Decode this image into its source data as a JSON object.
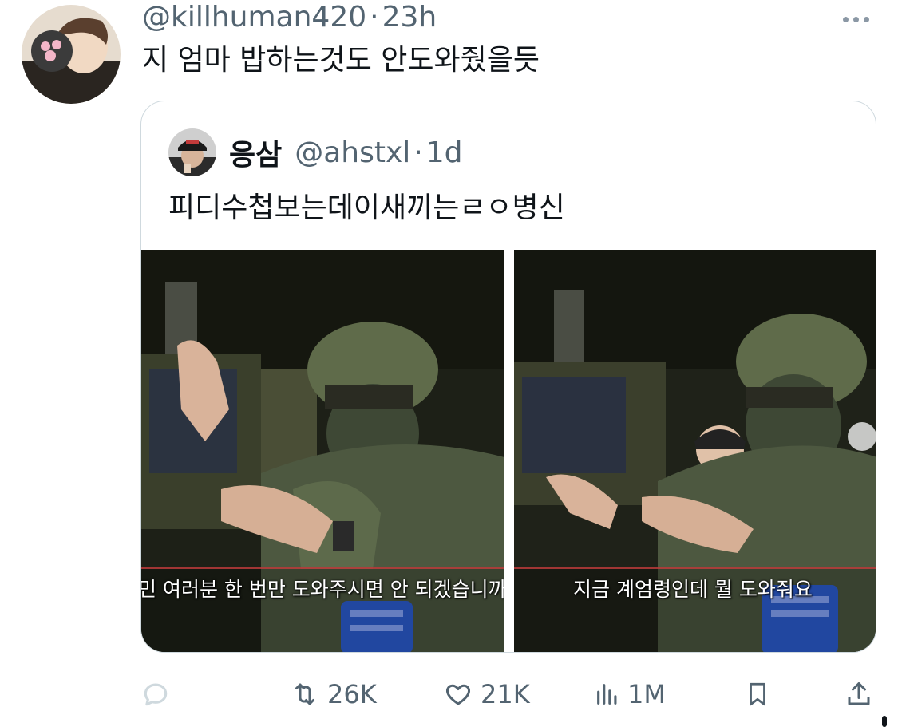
{
  "tweet": {
    "handle": "@killhuman420",
    "separator": "·",
    "time": "23h",
    "text": "지 엄마 밥하는것도 안도와줬을듯"
  },
  "quote": {
    "name": "응삼",
    "handle": "@ahstxl",
    "separator": "·",
    "time": "1d",
    "text": "피디수첩보는데이새끼는ㄹㅇ병신",
    "media": [
      {
        "subtitle": "민 여러분 한 번만 도와주시면 안 되겠습니까"
      },
      {
        "subtitle": "지금 계엄령인데 뭘 도와줘요"
      }
    ]
  },
  "actions": {
    "reply_icon": "reply-icon",
    "retweet_count": "26K",
    "like_count": "21K",
    "views_count": "1M",
    "bookmark_icon": "bookmark-icon",
    "share_icon": "share-icon"
  },
  "colors": {
    "text": "#0f1419",
    "secondary": "#536471",
    "border": "#cfd9de"
  }
}
